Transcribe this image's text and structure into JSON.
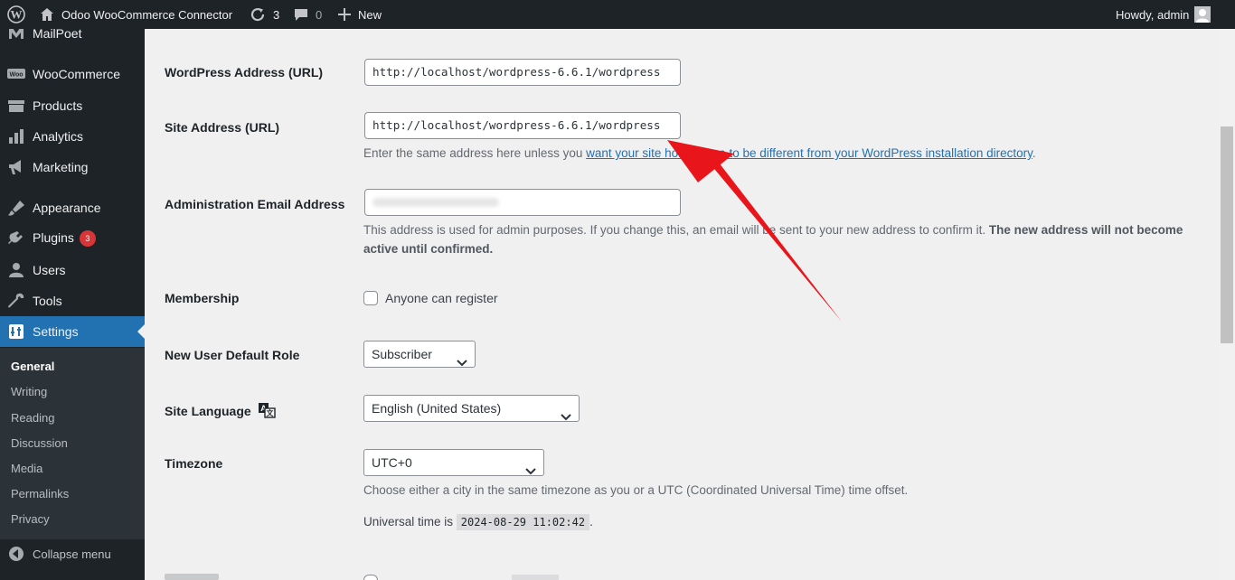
{
  "adminbar": {
    "site_name": "Odoo WooCommerce Connector",
    "updates_count": "3",
    "comments_count": "0",
    "new_label": "New",
    "howdy": "Howdy, admin"
  },
  "sidebar": {
    "items": [
      {
        "label": "MailPoet",
        "icon": "mailpoet-icon"
      },
      {
        "label": "WooCommerce",
        "icon": "woocommerce-icon"
      },
      {
        "label": "Products",
        "icon": "products-icon"
      },
      {
        "label": "Analytics",
        "icon": "analytics-icon"
      },
      {
        "label": "Marketing",
        "icon": "marketing-icon"
      },
      {
        "label": "Appearance",
        "icon": "appearance-icon"
      },
      {
        "label": "Plugins",
        "icon": "plugins-icon",
        "badge": "3"
      },
      {
        "label": "Users",
        "icon": "users-icon"
      },
      {
        "label": "Tools",
        "icon": "tools-icon"
      },
      {
        "label": "Settings",
        "icon": "settings-icon"
      }
    ],
    "submenu": [
      "General",
      "Writing",
      "Reading",
      "Discussion",
      "Media",
      "Permalinks",
      "Privacy"
    ],
    "collapse_label": "Collapse menu"
  },
  "form": {
    "wp_address_label": "WordPress Address (URL)",
    "wp_address_value": "http://localhost/wordpress-6.6.1/wordpress",
    "site_address_label": "Site Address (URL)",
    "site_address_value": "http://localhost/wordpress-6.6.1/wordpress",
    "site_address_desc_pre": "Enter the same address here unless you ",
    "site_address_desc_link": "want your site home page to be different from your WordPress installation directory",
    "site_address_desc_post": ".",
    "admin_email_label": "Administration Email Address",
    "admin_email_desc": "This address is used for admin purposes. If you change this, an email will be sent to your new address to confirm it.",
    "admin_email_desc_strong": "The new address will not become active until confirmed.",
    "membership_label": "Membership",
    "membership_checkbox_label": "Anyone can register",
    "default_role_label": "New User Default Role",
    "default_role_value": "Subscriber",
    "site_language_label": "Site Language",
    "site_language_value": "English (United States)",
    "timezone_label": "Timezone",
    "timezone_value": "UTC+0",
    "timezone_desc": "Choose either a city in the same timezone as you or a UTC (Coordinated Universal Time) time offset.",
    "universal_time_label": "Universal time is ",
    "universal_time_value": "2024-08-29 11:02:42",
    "universal_time_post": "."
  },
  "colors": {
    "admin_dark": "#1d2327",
    "accent": "#2271b1",
    "annotation_arrow": "#e8151b"
  }
}
